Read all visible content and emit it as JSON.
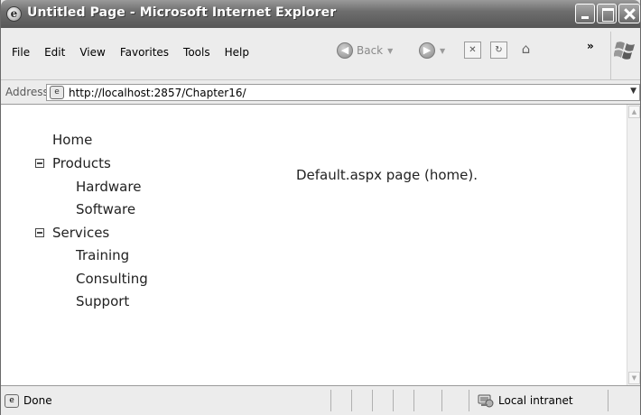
{
  "window": {
    "title": "Untitled Page - Microsoft Internet Explorer",
    "app_icon": "ie-icon"
  },
  "menu": {
    "items": [
      "File",
      "Edit",
      "View",
      "Favorites",
      "Tools",
      "Help"
    ]
  },
  "toolbar": {
    "back_label": "Back",
    "more_glyph": "»"
  },
  "address": {
    "label": "Address",
    "url": "http://localhost:2857/Chapter16/"
  },
  "tree": {
    "nodes": [
      {
        "label": "Home"
      },
      {
        "label": "Products",
        "expanded": true
      },
      {
        "label": "Hardware"
      },
      {
        "label": "Software"
      },
      {
        "label": "Services",
        "expanded": true
      },
      {
        "label": "Training"
      },
      {
        "label": "Consulting"
      },
      {
        "label": "Support"
      }
    ]
  },
  "main": {
    "text": "Default.aspx page (home)."
  },
  "status": {
    "text": "Done",
    "zone": "Local intranet"
  }
}
